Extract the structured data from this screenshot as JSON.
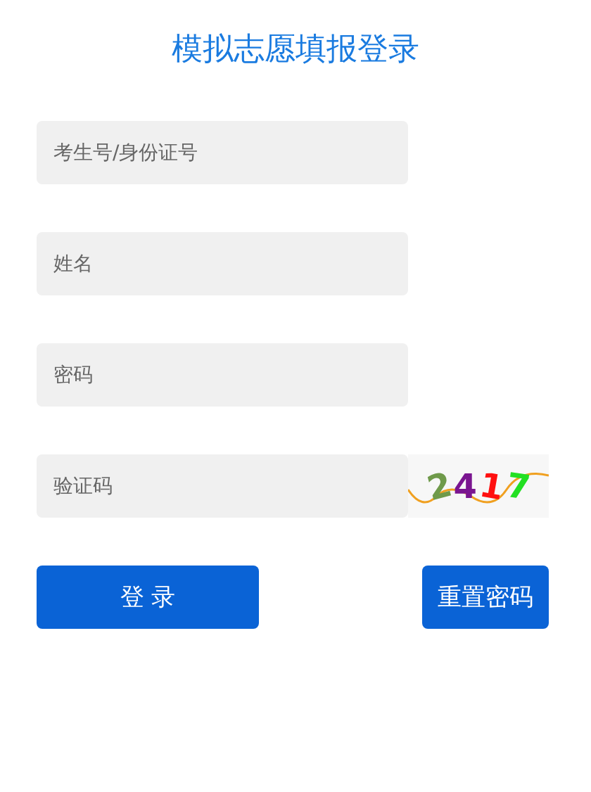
{
  "title": "模拟志愿填报登录",
  "fields": [
    {
      "placeholder": "考生号/身份证号"
    },
    {
      "placeholder": "姓名"
    },
    {
      "placeholder": "密码"
    },
    {
      "placeholder": "验证码"
    }
  ],
  "captcha": "2417",
  "buttons": {
    "login": "登 录",
    "reset": "重置密码"
  }
}
